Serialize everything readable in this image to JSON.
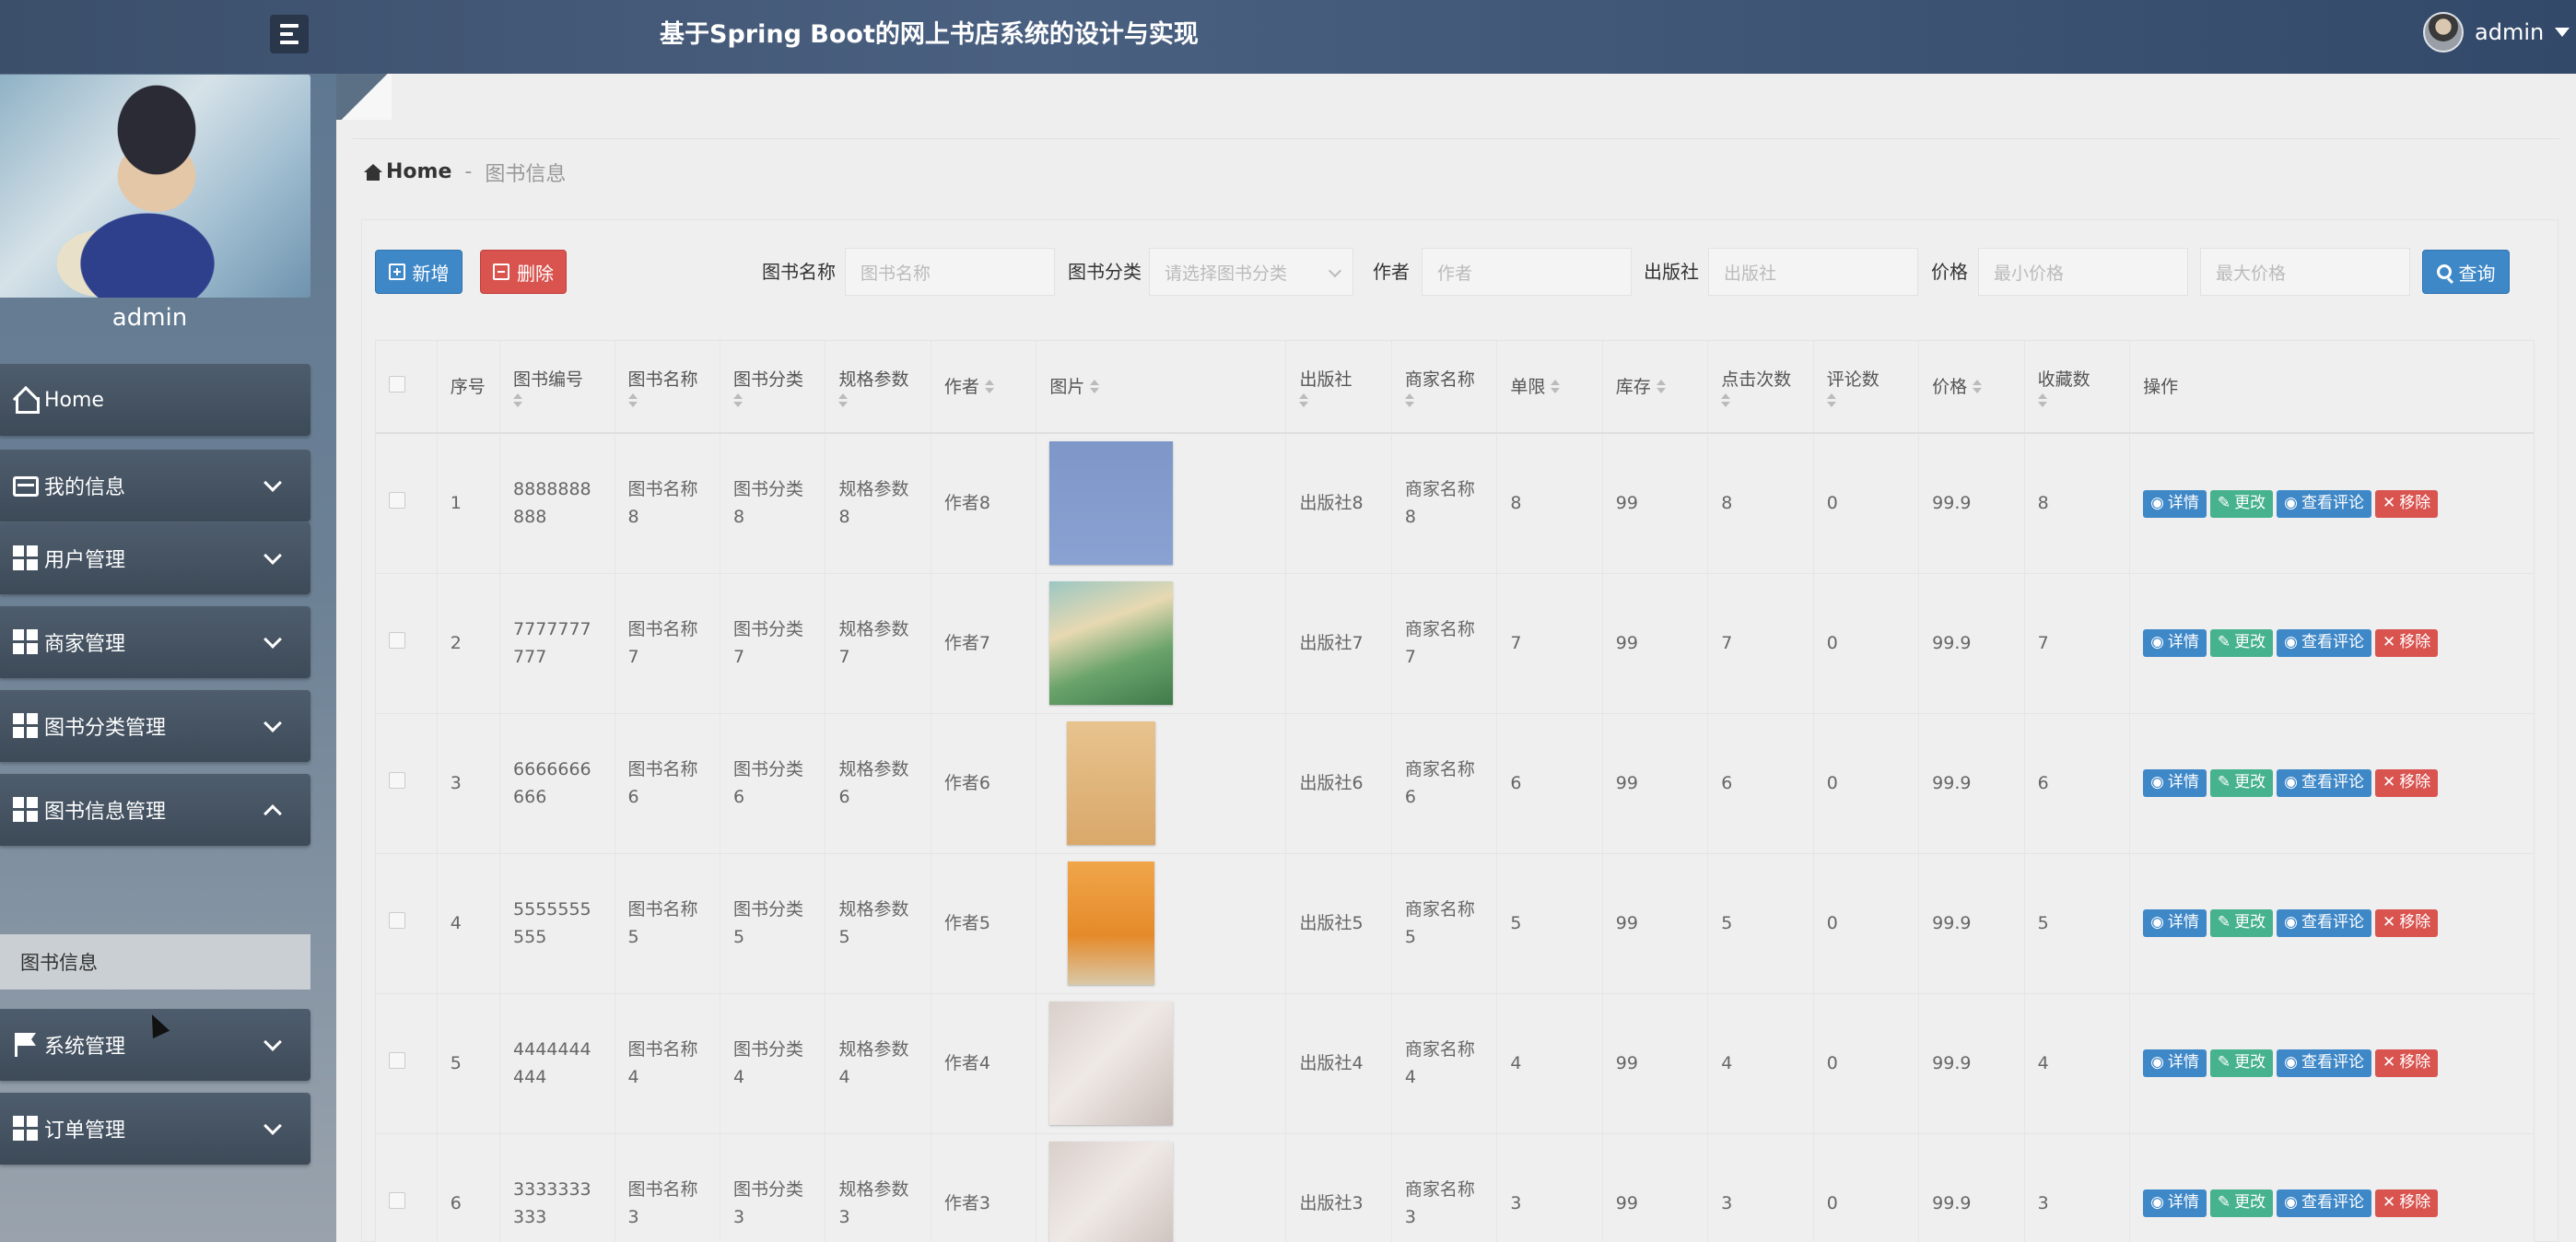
{
  "app": {
    "title": "基于Spring Boot的网上书店系统的设计与实现",
    "user": "admin"
  },
  "sidebar": {
    "profile_name": "admin",
    "items": [
      {
        "label": "Home",
        "icon": "home-icon"
      },
      {
        "label": "我的信息",
        "icon": "id-card-icon"
      },
      {
        "label": "用户管理",
        "icon": "grid-icon"
      },
      {
        "label": "商家管理",
        "icon": "grid-icon"
      },
      {
        "label": "图书分类管理",
        "icon": "grid-icon"
      },
      {
        "label": "图书信息管理",
        "icon": "grid-icon"
      },
      {
        "label": "系统管理",
        "icon": "flag-icon"
      },
      {
        "label": "订单管理",
        "icon": "grid-icon"
      }
    ],
    "sub_item": "图书信息"
  },
  "breadcrumb": {
    "home": "Home",
    "sep": "-",
    "current": "图书信息"
  },
  "toolbar": {
    "add": "新增",
    "delete": "删除",
    "search": "查询",
    "filters": {
      "name_label": "图书名称",
      "name_placeholder": "图书名称",
      "category_label": "图书分类",
      "category_placeholder": "请选择图书分类",
      "author_label": "作者",
      "author_placeholder": "作者",
      "publisher_label": "出版社",
      "publisher_placeholder": "出版社",
      "price_label": "价格",
      "min_price_placeholder": "最小价格",
      "max_price_placeholder": "最大价格"
    }
  },
  "table": {
    "headers": {
      "index": "序号",
      "code": "图书编号",
      "name": "图书名称",
      "category": "图书分类",
      "spec": "规格参数",
      "author": "作者",
      "image": "图片",
      "publisher": "出版社",
      "merchant": "商家名称",
      "limit": "单限",
      "stock": "库存",
      "clicks": "点击次数",
      "comments": "评论数",
      "price": "价格",
      "favorites": "收藏数",
      "actions": "操作"
    },
    "actions": {
      "detail": "详情",
      "edit": "更改",
      "comment": "查看评论",
      "remove": "移除"
    },
    "rows": [
      {
        "index": "1",
        "code": "8888888888",
        "name": "图书名称8",
        "category": "图书分类8",
        "spec": "规格参数8",
        "author": "作者8",
        "cover": "cover-blue",
        "publisher": "出版社8",
        "merchant": "商家名称8",
        "limit": "8",
        "stock": "99",
        "clicks": "8",
        "comments": "0",
        "price": "99.9",
        "favorites": "8"
      },
      {
        "index": "2",
        "code": "7777777777",
        "name": "图书名称7",
        "category": "图书分类7",
        "spec": "规格参数7",
        "author": "作者7",
        "cover": "cover-green",
        "publisher": "出版社7",
        "merchant": "商家名称7",
        "limit": "7",
        "stock": "99",
        "clicks": "7",
        "comments": "0",
        "price": "99.9",
        "favorites": "7"
      },
      {
        "index": "3",
        "code": "6666666666",
        "name": "图书名称6",
        "category": "图书分类6",
        "spec": "规格参数6",
        "author": "作者6",
        "cover": "cover-tan",
        "publisher": "出版社6",
        "merchant": "商家名称6",
        "limit": "6",
        "stock": "99",
        "clicks": "6",
        "comments": "0",
        "price": "99.9",
        "favorites": "6"
      },
      {
        "index": "4",
        "code": "5555555555",
        "name": "图书名称5",
        "category": "图书分类5",
        "spec": "规格参数5",
        "author": "作者5",
        "cover": "cover-orange",
        "publisher": "出版社5",
        "merchant": "商家名称5",
        "limit": "5",
        "stock": "99",
        "clicks": "5",
        "comments": "0",
        "price": "99.9",
        "favorites": "5"
      },
      {
        "index": "5",
        "code": "4444444444",
        "name": "图书名称4",
        "category": "图书分类4",
        "spec": "规格参数4",
        "author": "作者4",
        "cover": "cover-grey",
        "publisher": "出版社4",
        "merchant": "商家名称4",
        "limit": "4",
        "stock": "99",
        "clicks": "4",
        "comments": "0",
        "price": "99.9",
        "favorites": "4"
      },
      {
        "index": "6",
        "code": "3333333333",
        "name": "图书名称3",
        "category": "图书分类3",
        "spec": "规格参数3",
        "author": "作者3",
        "cover": "cover-grey",
        "publisher": "出版社3",
        "merchant": "商家名称3",
        "limit": "3",
        "stock": "99",
        "clicks": "3",
        "comments": "0",
        "price": "99.9",
        "favorites": "3"
      }
    ]
  },
  "colors": {
    "primary": "#3f88c8",
    "danger": "#d9534f",
    "success": "#47b28e",
    "nav": "#3d4a58"
  }
}
